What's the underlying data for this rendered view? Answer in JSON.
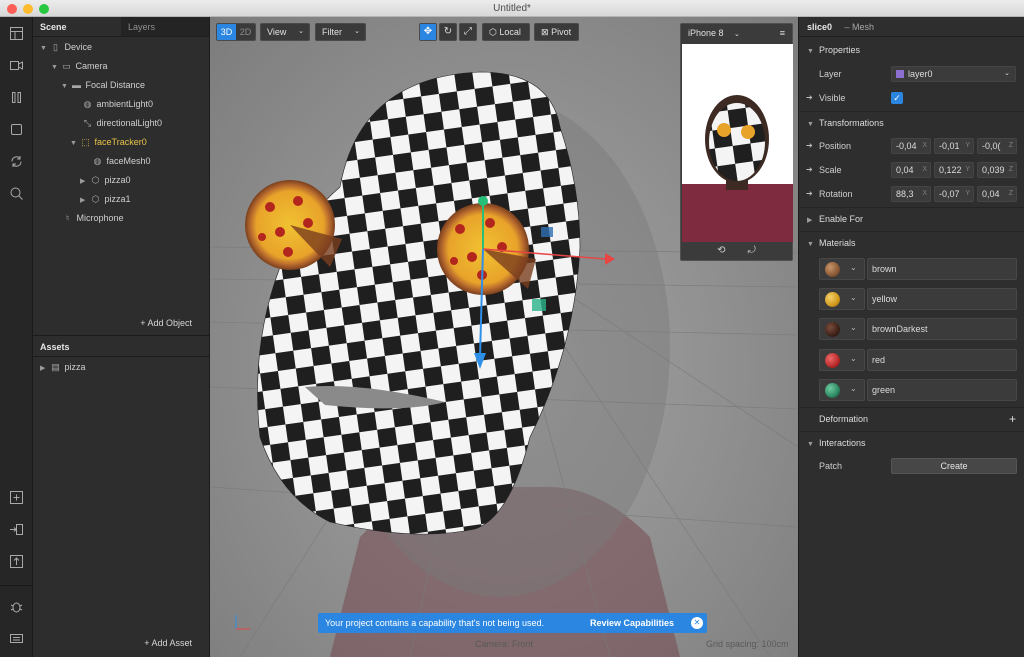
{
  "window": {
    "title": "Untitled*"
  },
  "toolstrip": {
    "top_tools": [
      "layout-icon",
      "video-icon",
      "pause-icon",
      "stop-icon",
      "refresh-icon",
      "search-icon"
    ],
    "bottom_tools": [
      "add-panel-icon",
      "export-icon",
      "upload-icon",
      "bug-icon",
      "keyboard-icon"
    ]
  },
  "scene": {
    "tabs": [
      "Scene",
      "Layers"
    ],
    "tree": [
      {
        "label": "Device",
        "icon": "device-icon"
      },
      {
        "label": "Camera",
        "icon": "camera-icon"
      },
      {
        "label": "Focal Distance",
        "icon": "focal-icon"
      },
      {
        "label": "ambientLight0",
        "icon": "globe-icon"
      },
      {
        "label": "directionalLight0",
        "icon": "light-icon"
      },
      {
        "label": "faceTracker0",
        "icon": "face-tracker-icon"
      },
      {
        "label": "faceMesh0",
        "icon": "mesh-icon"
      },
      {
        "label": "pizza0",
        "icon": "cube-icon"
      },
      {
        "label": "pizza1",
        "icon": "cube-icon"
      },
      {
        "label": "Microphone",
        "icon": "microphone-icon"
      }
    ],
    "add_object": "+ Add Object",
    "assets_title": "Assets",
    "assets": [
      {
        "label": "pizza",
        "icon": "file-icon"
      }
    ],
    "add_asset": "+ Add Asset"
  },
  "viewport": {
    "mode_3d": "3D",
    "mode_2d": "2D",
    "view_label": "View",
    "filter_label": "Filter",
    "local_label": "Local",
    "pivot_label": "Pivot",
    "device": "iPhone 8",
    "banner_text": "Your project contains a capability that's not being used.",
    "banner_action": "Review Capabilities",
    "camera_label": "Camera: Front",
    "grid_label": "Grid spacing: 100cm",
    "accent": "#2a86e0"
  },
  "inspector": {
    "object_name": "slice0",
    "object_type": "– Mesh",
    "properties_title": "Properties",
    "layer_label": "Layer",
    "layer_value": "layer0",
    "layer_color": "#8b6fd1",
    "visible_label": "Visible",
    "transformations_title": "Transformations",
    "position_label": "Position",
    "position": [
      "-0,04",
      "-0,01",
      "-0,0("
    ],
    "scale_label": "Scale",
    "scale": [
      "0,04",
      "0,122",
      "0,039"
    ],
    "rotation_label": "Rotation",
    "rotation": [
      "88,3",
      "-0,07",
      "0,04"
    ],
    "axes": [
      "X",
      "Y",
      "Z"
    ],
    "enable_for_title": "Enable For",
    "materials_title": "Materials",
    "materials": [
      {
        "name": "brown",
        "color": "#8a5a36"
      },
      {
        "name": "yellow",
        "color": "#d39a1d"
      },
      {
        "name": "brownDarkest",
        "color": "#3f2218"
      },
      {
        "name": "red",
        "color": "#b82a2a"
      },
      {
        "name": "green",
        "color": "#2e8a63"
      }
    ],
    "deformation_title": "Deformation",
    "deformation_add": "+",
    "interactions_title": "Interactions",
    "patch_label": "Patch",
    "create_label": "Create"
  }
}
